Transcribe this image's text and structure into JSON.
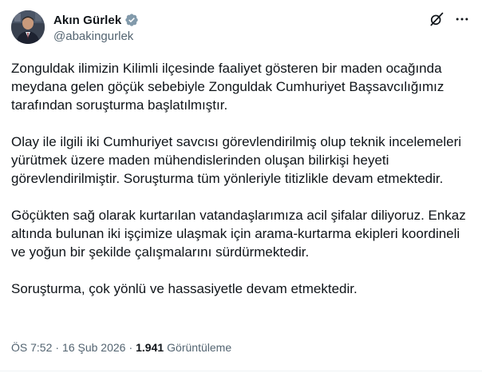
{
  "author": {
    "display_name": "Akın Gürlek",
    "handle": "@abakingurlek",
    "verified": true
  },
  "icons": {
    "avatar": "avatar-portrait",
    "verified": "verified-badge-icon",
    "grok": "grok-icon",
    "more": "more-options-icon"
  },
  "colors": {
    "verified": "#829aab",
    "text": "#0f1419",
    "secondary": "#536471"
  },
  "tweet": {
    "paragraphs": [
      "Zonguldak ilimizin Kilimli ilçesinde faaliyet gösteren bir maden ocağında meydana gelen göçük sebebiyle Zonguldak Cumhuriyet Başsavcılığımız tarafından soruşturma başlatılmıştır.",
      "Olay ile ilgili iki Cumhuriyet savcısı görevlendirilmiş olup teknik incelemeleri yürütmek üzere maden mühendislerinden oluşan bilirkişi heyeti görevlendirilmiştir. Soruşturma tüm yönleriyle titizlikle devam etmektedir.",
      "Göçükten sağ olarak kurtarılan vatandaşlarımıza acil şifalar diliyoruz. Enkaz altında bulunan iki işçimize ulaşmak için arama-kurtarma ekipleri koordineli ve yoğun bir şekilde çalışmalarını sürdürmektedir.",
      "Soruşturma, çok yönlü ve hassasiyetle devam etmektedir."
    ]
  },
  "meta": {
    "time": "ÖS 7:52",
    "separator_1": "·",
    "date": "16 Şub 2026",
    "separator_2": "·",
    "views_count": "1.941",
    "views_label": "Görüntüleme"
  }
}
